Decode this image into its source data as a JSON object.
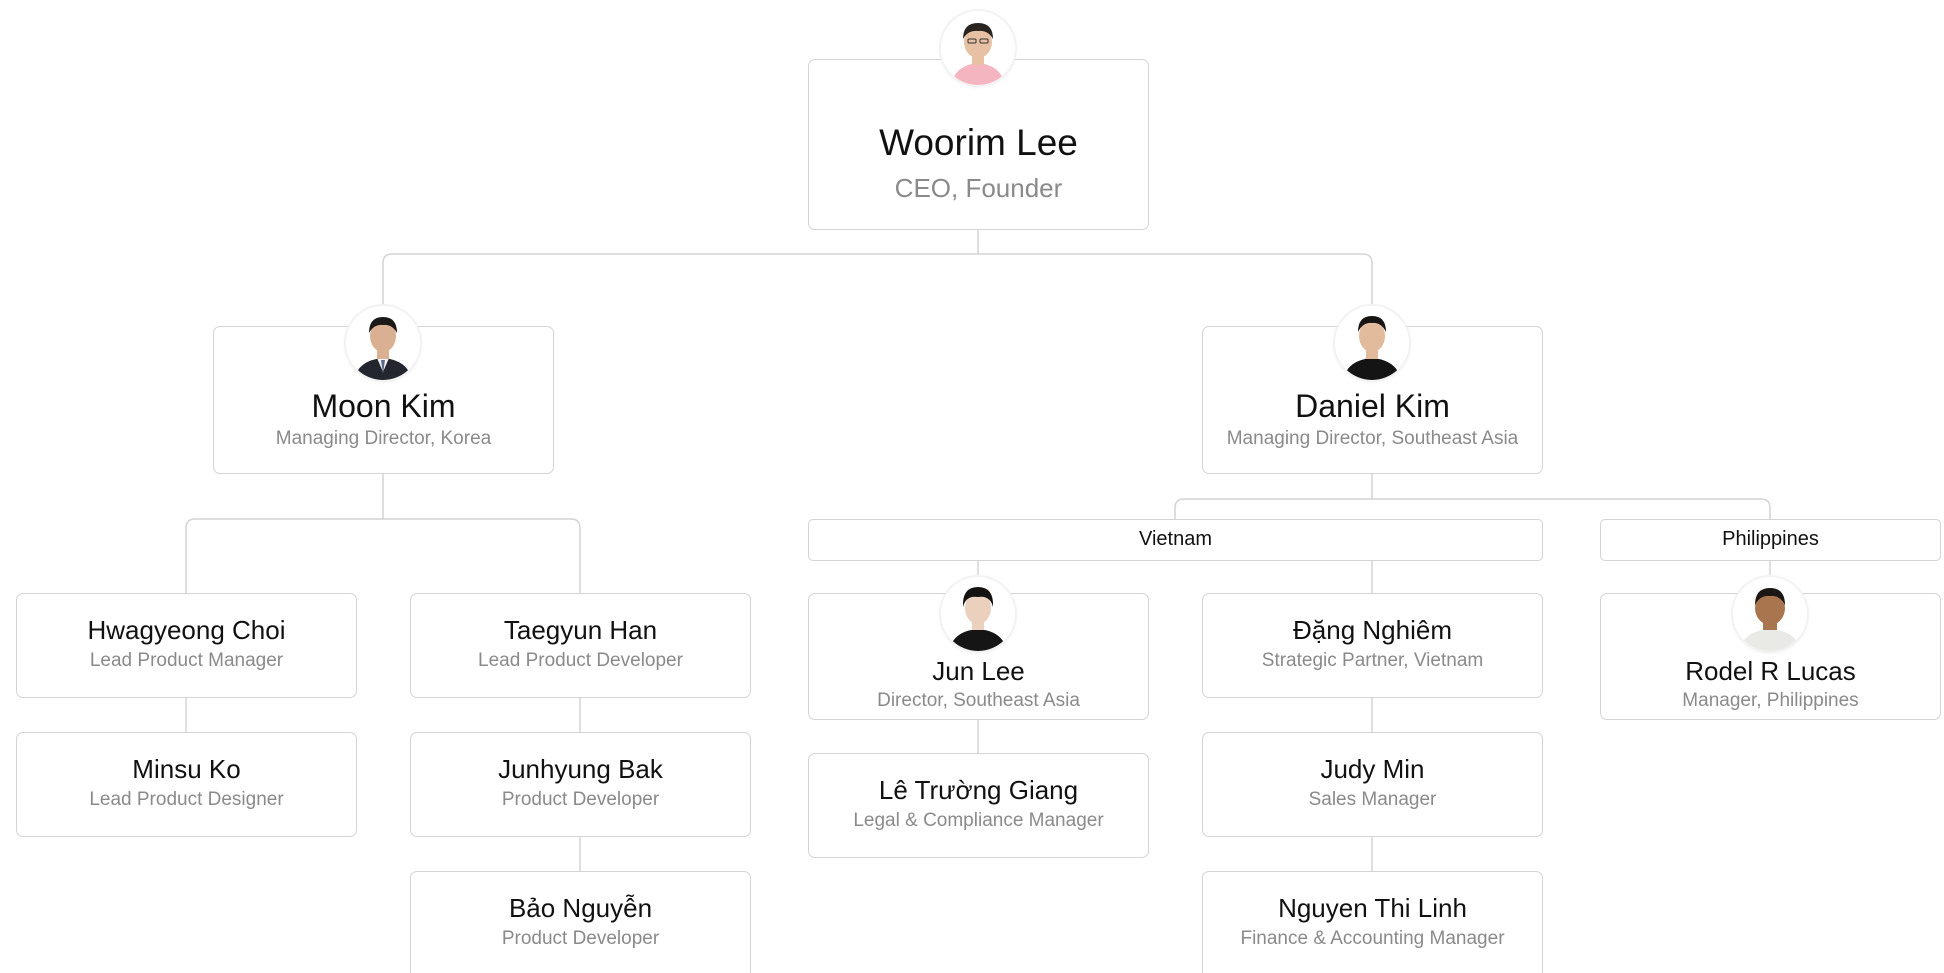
{
  "nodes": {
    "woorim": {
      "name": "Woorim Lee",
      "title": "CEO, Founder"
    },
    "moon": {
      "name": "Moon Kim",
      "title": "Managing Director, Korea"
    },
    "daniel": {
      "name": "Daniel Kim",
      "title": "Managing Director, Southeast Asia"
    },
    "hwagyeong": {
      "name": "Hwagyeong Choi",
      "title": "Lead Product Manager"
    },
    "minsu": {
      "name": "Minsu Ko",
      "title": "Lead Product Designer"
    },
    "taegyun": {
      "name": "Taegyun Han",
      "title": "Lead Product Developer"
    },
    "junhyung": {
      "name": "Junhyung Bak",
      "title": "Product Developer"
    },
    "bao": {
      "name": "Bảo Nguyễn",
      "title": "Product Developer"
    },
    "junlee": {
      "name": "Jun Lee",
      "title": "Director, Southeast Asia"
    },
    "le": {
      "name": "Lê Trường Giang",
      "title": "Legal & Compliance Manager"
    },
    "dang": {
      "name": "Đặng Nghiêm",
      "title": "Strategic Partner, Vietnam"
    },
    "judy": {
      "name": "Judy Min",
      "title": "Sales Manager"
    },
    "nguyen": {
      "name": "Nguyen Thi Linh",
      "title": "Finance & Accounting Manager"
    },
    "rodel": {
      "name": "Rodel R Lucas",
      "title": "Manager, Philippines"
    }
  },
  "groups": {
    "vietnam": "Vietnam",
    "philippines": "Philippines"
  },
  "colors": {
    "card_border": "#d4d4d4",
    "connector": "#d4d4d4",
    "name_text": "#111111",
    "title_text": "#8a8a8a",
    "background": "#ffffff"
  },
  "avatars": {
    "woorim": {
      "icon": "person-photo-icon",
      "shirt": "#f5b5c0",
      "skin": "#e8c0a3",
      "hair": "#2a2420"
    },
    "moon": {
      "icon": "person-photo-icon",
      "shirt": "#23262f",
      "skin": "#d9b091",
      "hair": "#1c1a18"
    },
    "daniel": {
      "icon": "person-photo-icon",
      "shirt": "#141414",
      "skin": "#e2bb9d",
      "hair": "#171514"
    },
    "junlee": {
      "icon": "person-photo-icon",
      "shirt": "#151515",
      "skin": "#ead0bd",
      "hair": "#141210"
    },
    "rodel": {
      "icon": "person-photo-icon",
      "shirt": "#e9e9e6",
      "skin": "#a8754f",
      "hair": "#1b1714"
    }
  }
}
